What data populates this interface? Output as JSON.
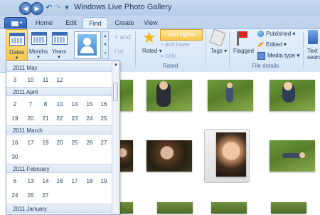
{
  "window": {
    "title": "Windows Live Photo Gallery"
  },
  "quick_access": {
    "back": "◀",
    "forward": "▶",
    "undo": "↶",
    "redo": "↷",
    "menu": "▾"
  },
  "tabs": [
    {
      "label": "Home"
    },
    {
      "label": "Edit"
    },
    {
      "label": "Find"
    },
    {
      "label": "Create"
    },
    {
      "label": "View"
    }
  ],
  "active_tab": "Find",
  "ribbon": {
    "dates": "Dates",
    "months": "Months",
    "years": "Years",
    "and": "and",
    "or": "or",
    "rated": "Rated",
    "and_higher": "and higher",
    "and_lower": "and lower",
    "only": "only",
    "rated_group": "Rated",
    "tags": "Tags",
    "flagged": "Flagged",
    "published": "Published",
    "edited": "Edited",
    "media_type": "Media type",
    "file_details_group": "File details",
    "text_search_1": "Text",
    "text_search_2": "search"
  },
  "calendar": {
    "months": [
      {
        "label": "2011 May",
        "days": [
          "3",
          "10",
          "11",
          "12"
        ]
      },
      {
        "label": "2011 April",
        "days": [
          "2",
          "7",
          "8",
          "10",
          "14",
          "15",
          "16",
          "19",
          "20",
          "21",
          "22",
          "23",
          "24",
          "25"
        ]
      },
      {
        "label": "2011 March",
        "days": [
          "16",
          "17",
          "19",
          "20",
          "25",
          "26",
          "27",
          "30"
        ]
      },
      {
        "label": "2011 February",
        "days": [
          "6",
          "13",
          "14",
          "16",
          "17",
          "18",
          "19",
          "24",
          "26",
          "27"
        ]
      },
      {
        "label": "2011 January",
        "days": []
      }
    ]
  },
  "colors": {
    "accent": "#f8c64c",
    "ribbon": "#dbe8f7",
    "text": "#1e395b"
  }
}
